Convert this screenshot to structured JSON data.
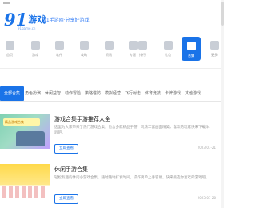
{
  "header": {
    "logo_num": "91",
    "logo_word": "游戏",
    "logo_sub": "91game.cn",
    "tagline": "91手游网·分享好游戏"
  },
  "nav": {
    "items": [
      {
        "label": "首页",
        "icon": "home-icon"
      },
      {
        "label": "游戏",
        "icon": "game-icon"
      },
      {
        "label": "软件",
        "icon": "app-icon"
      },
      {
        "label": "攻略",
        "icon": "guide-icon"
      },
      {
        "label": "资讯",
        "icon": "news-icon"
      },
      {
        "label": "专题",
        "icon": "topic-icon"
      },
      {
        "label": "排行",
        "icon": "rank-icon"
      },
      {
        "label": "礼包",
        "icon": "gift-icon"
      },
      {
        "label": "合集",
        "icon": "collection-icon",
        "active": true
      },
      {
        "label": "更多",
        "icon": "more-icon"
      }
    ]
  },
  "tabs": [
    {
      "label": "全部合集",
      "active": true
    },
    {
      "label": "角色扮演"
    },
    {
      "label": "休闲益智"
    },
    {
      "label": "动作冒险"
    },
    {
      "label": "策略塔防"
    },
    {
      "label": "模拟经营"
    },
    {
      "label": "飞行射击"
    },
    {
      "label": "体育竞技"
    },
    {
      "label": "卡牌游戏"
    },
    {
      "label": "其他游戏"
    }
  ],
  "cards": [
    {
      "title": "游戏合集手游推荐大全",
      "desc": "这里为大家带来了热门游戏合集，包含多款精品手游，玩法丰富画面精美，喜欢的玩家快来下载体验吧。",
      "button": "立即查看",
      "date": "2023-07-21",
      "thumb_banner": "精品游戏合集"
    },
    {
      "title": "休闲手游合集",
      "desc": "轻松有趣的休闲小游戏合集，随时随地打发时间，操作简单上手容易，快来挑选你喜欢的游戏吧。",
      "button": "立即查看",
      "date": "2023-07-20"
    }
  ]
}
